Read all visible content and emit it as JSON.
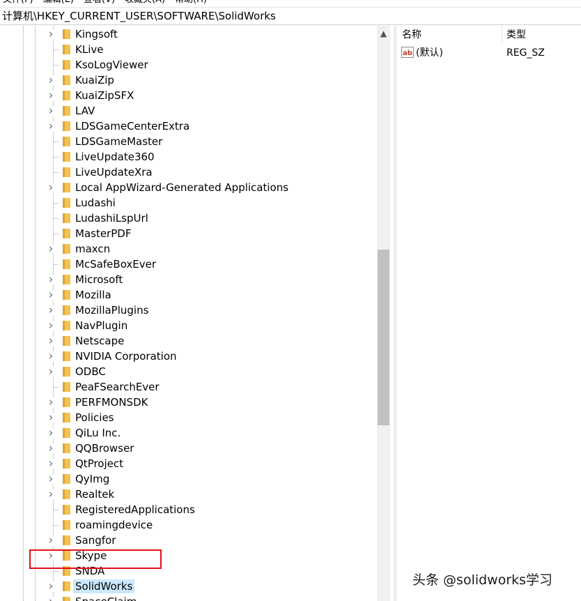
{
  "menu": [
    {
      "label": "文件(F)"
    },
    {
      "label": "编辑(E)"
    },
    {
      "label": "查看(V)"
    },
    {
      "label": "收藏夹(A)"
    },
    {
      "label": "帮助(H)"
    }
  ],
  "address": {
    "path": "计算机\\HKEY_CURRENT_USER\\SOFTWARE\\SolidWorks"
  },
  "tree": {
    "items": [
      {
        "label": "Kingsoft",
        "expandable": true
      },
      {
        "label": "KLive",
        "expandable": false
      },
      {
        "label": "KsoLogViewer",
        "expandable": false
      },
      {
        "label": "KuaiZip",
        "expandable": true
      },
      {
        "label": "KuaiZipSFX",
        "expandable": true
      },
      {
        "label": "LAV",
        "expandable": true
      },
      {
        "label": "LDSGameCenterExtra",
        "expandable": true
      },
      {
        "label": "LDSGameMaster",
        "expandable": false
      },
      {
        "label": "LiveUpdate360",
        "expandable": false
      },
      {
        "label": "LiveUpdateXra",
        "expandable": false
      },
      {
        "label": "Local AppWizard-Generated Applications",
        "expandable": true
      },
      {
        "label": "Ludashi",
        "expandable": false
      },
      {
        "label": "LudashiLspUrl",
        "expandable": false
      },
      {
        "label": "MasterPDF",
        "expandable": false
      },
      {
        "label": "maxcn",
        "expandable": true
      },
      {
        "label": "McSafeBoxEver",
        "expandable": false
      },
      {
        "label": "Microsoft",
        "expandable": true
      },
      {
        "label": "Mozilla",
        "expandable": true
      },
      {
        "label": "MozillaPlugins",
        "expandable": true
      },
      {
        "label": "NavPlugin",
        "expandable": true
      },
      {
        "label": "Netscape",
        "expandable": true
      },
      {
        "label": "NVIDIA Corporation",
        "expandable": true
      },
      {
        "label": "ODBC",
        "expandable": true
      },
      {
        "label": "PeaFSearchEver",
        "expandable": false
      },
      {
        "label": "PERFMONSDK",
        "expandable": true
      },
      {
        "label": "Policies",
        "expandable": true
      },
      {
        "label": "QiLu Inc.",
        "expandable": true
      },
      {
        "label": "QQBrowser",
        "expandable": true
      },
      {
        "label": "QtProject",
        "expandable": true
      },
      {
        "label": "QyImg",
        "expandable": true
      },
      {
        "label": "Realtek",
        "expandable": true
      },
      {
        "label": "RegisteredApplications",
        "expandable": false
      },
      {
        "label": "roamingdevice",
        "expandable": false
      },
      {
        "label": "Sangfor",
        "expandable": true
      },
      {
        "label": "Skype",
        "expandable": true
      },
      {
        "label": "SNDA",
        "expandable": false
      },
      {
        "label": "SolidWorks",
        "expandable": true,
        "selected": true
      },
      {
        "label": "SpaceClaim",
        "expandable": true
      }
    ]
  },
  "list": {
    "columns": {
      "name": "名称",
      "type": "类型"
    },
    "values": [
      {
        "name": "(默认)",
        "type": "REG_SZ"
      }
    ]
  },
  "watermark": "头条 @solidworks学习",
  "colors": {
    "selection": "#cce8ff",
    "highlight_border": "#e0101a",
    "folder": "#f3c24f"
  }
}
